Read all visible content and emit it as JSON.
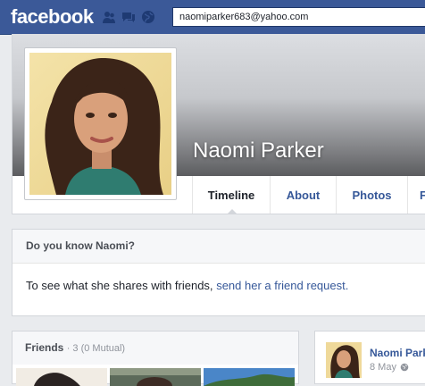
{
  "topbar": {
    "logo": "facebook",
    "search_value": "naomiparker683@yahoo.com",
    "icons": [
      "friend-requests-icon",
      "messages-icon",
      "notifications-globe-icon"
    ]
  },
  "profile": {
    "name": "Naomi Parker",
    "tabs": [
      "Timeline",
      "About",
      "Photos",
      "F"
    ],
    "active_tab": "Timeline"
  },
  "know": {
    "heading": "Do you know Naomi?",
    "text": "To see what she shares with friends,",
    "link": "send her a friend request."
  },
  "friends": {
    "title": "Friends",
    "count": "· 3 (0 Mutual)"
  },
  "post": {
    "name": "Naomi Park",
    "date": "8 May",
    "privacy_icon": "globe-icon"
  },
  "colors": {
    "brand": "#3b5998",
    "link": "#365899",
    "background": "#e9ebee"
  }
}
